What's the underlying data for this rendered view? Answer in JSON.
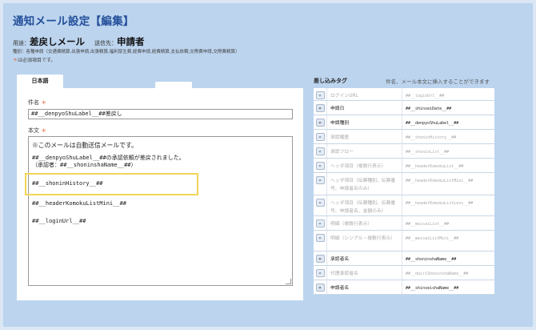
{
  "header": {
    "title": "通知メール設定【編集】",
    "purpose_label": "用途：",
    "purpose_value": "差戻しメール",
    "recipient_label": "送信先：",
    "recipient_value": "申請者",
    "type_label": "種別：",
    "type_value": "各種申請（交通費精算,出張申請,出張精算,福利厚生費,経費申請,経費精算,支払依頼,交際費申請,交際費精算）",
    "required_mark": "＊",
    "required_note": "は必須項目です。"
  },
  "tabs": [
    {
      "label": "日本語"
    }
  ],
  "form": {
    "subject_label": "件名",
    "subject_value": "##__denpyoShuLabel__##差戻し",
    "body_label": "本文",
    "required_mark": "＊",
    "body_lines": [
      "※このメールは自動送信メールです。",
      "##__denpyoShuLabel__##の承認依頼が差戻されました。",
      "（承認者：##__shoninshaName__##）",
      "##__shoninHistory__##",
      "##__headerKomokuListMini__##",
      "##__loginUrl__##"
    ]
  },
  "tags_panel": {
    "title": "差し込みタグ",
    "note": "件名、メール本文に挿入することができます",
    "insert_glyph": "«",
    "rows": [
      {
        "name": "ログインURL",
        "code": "##__loginUrl__##",
        "active": false
      },
      {
        "name": "申請日",
        "code": "##__shinseiDate__##",
        "active": true
      },
      {
        "name": "申請種別",
        "code": "##__denpyoShuLabel__##",
        "active": true
      },
      {
        "name": "承認履歴",
        "code": "##__shoninHistory__##",
        "active": false
      },
      {
        "name": "承認フロー",
        "code": "##__shoninList__##",
        "active": false
      },
      {
        "name": "ヘッダ項目（複数行表示）",
        "code": "##__headerKomokuList__##",
        "active": false
      },
      {
        "name": "ヘッダ項目（伝票種別、伝票番号、申請者名のみ）",
        "code": "##__headerKomokuListMini__##",
        "active": false
      },
      {
        "name": "ヘッダ項目（伝票種別、伝票番号、申請者名、金額のみ）",
        "code": "##__headerKomokuListLess__##",
        "active": false
      },
      {
        "name": "明細（複数行表示）",
        "code": "##__meisaiList__##",
        "active": false
      },
      {
        "name": "明細（シンプル・複数行表示）",
        "code": "##__meisaiListMini__##",
        "active": false
      },
      {
        "name": "承認者名",
        "code": "##__shoninshaName__##",
        "active": true
      },
      {
        "name": "代理承認者名",
        "code": "##__dairiShoninshaName__##",
        "active": false
      },
      {
        "name": "申請者名",
        "code": "##__shinseishaName__##",
        "active": true
      }
    ]
  },
  "colors": {
    "title": "#234f9a",
    "required": "#e0623c",
    "highlight": "#f3d55a",
    "page_bg": "#bcd4ee"
  }
}
